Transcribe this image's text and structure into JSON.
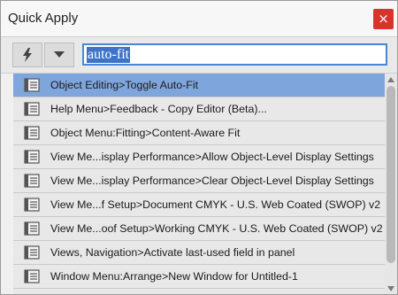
{
  "window": {
    "title": "Quick Apply",
    "close_label": "×"
  },
  "toolbar": {
    "search_value": "auto-fit"
  },
  "items": [
    {
      "label": "Object Editing>Toggle Auto-Fit",
      "selected": true
    },
    {
      "label": "Help Menu>Feedback - Copy Editor (Beta)..."
    },
    {
      "label": "Object Menu:Fitting>Content-Aware Fit"
    },
    {
      "label": "View Me...isplay Performance>Allow Object-Level Display Settings"
    },
    {
      "label": "View Me...isplay Performance>Clear Object-Level Display Settings"
    },
    {
      "label": "View Me...f Setup>Document CMYK - U.S. Web Coated (SWOP) v2"
    },
    {
      "label": "View Me...oof Setup>Working CMYK - U.S. Web Coated (SWOP) v2"
    },
    {
      "label": "Views, Navigation>Activate last-used field in panel"
    },
    {
      "label": "Window Menu:Arrange>New Window for Untitled-1"
    }
  ],
  "colors": {
    "selection": "#7fa6dc",
    "close": "#d9342b",
    "search_border": "#4a86d6"
  },
  "icons": {
    "toolbar": [
      "lightning-icon",
      "dropdown-arrow-icon"
    ],
    "item": "document-icon"
  }
}
